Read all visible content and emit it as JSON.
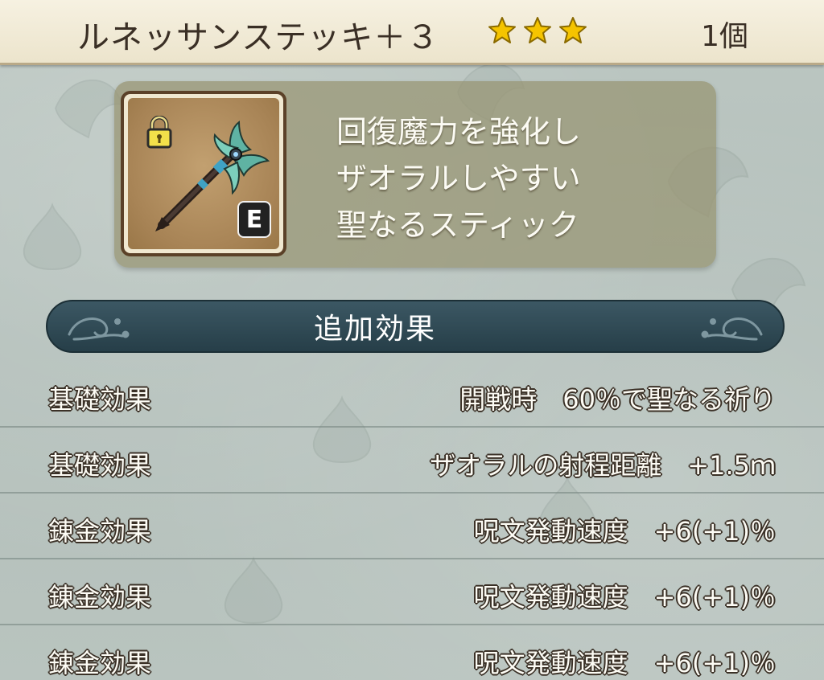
{
  "header": {
    "item_name": "ルネッサンステッキ＋３",
    "rarity_stars": 3,
    "star_icon": "star-icon",
    "quantity": "1個"
  },
  "item": {
    "icon": "staff-icon",
    "lock_icon": "lock-icon",
    "equipped_badge": "E",
    "description_lines": [
      "回復魔力を強化し",
      "ザオラルしやすい",
      "聖なるスティック"
    ]
  },
  "section": {
    "title": "追加効果"
  },
  "effects": [
    {
      "label": "基礎効果",
      "value": "開戦時　60％で聖なる祈り"
    },
    {
      "label": "基礎効果",
      "value": "ザオラルの射程距離　+1.5ｍ"
    },
    {
      "label": "錬金効果",
      "value": "呪文発動速度　+6(+1)％"
    },
    {
      "label": "錬金効果",
      "value": "呪文発動速度　+6(+1)％"
    },
    {
      "label": "錬金効果",
      "value": "呪文発動速度　+6(+1)％"
    }
  ],
  "colors": {
    "header_bg": "#f0e9d3",
    "banner_bg": "#2f4a55",
    "star": "#f5c400",
    "background": "#b7c2bd"
  }
}
